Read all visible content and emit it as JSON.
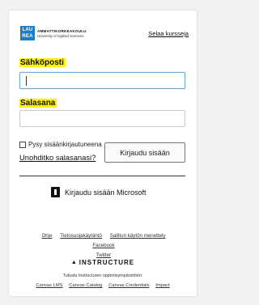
{
  "header": {
    "logo_mark": "LAU\nREA",
    "logo_line1": "AMMATTIKORKEAKOULU",
    "logo_line2": "University of Applied Sciences",
    "browse_courses": "Selaa kursseja"
  },
  "form": {
    "email_label": "Sähköposti",
    "password_label": "Salasana",
    "email_value": "",
    "password_value": "",
    "remember_label": "Pysy sisäänkirjautuneena",
    "forgot_link": "Unohditko salasanasi?",
    "login_button": "Kirjaudu sisään",
    "microsoft_login": "Kirjaudu sisään Microsoft"
  },
  "footer": {
    "links": [
      "Ohje",
      "Tietosuojakäytäntö",
      "Sallitun käytön menettely",
      "Facebook",
      "Twitter"
    ],
    "brand": "INSTRUCTURE",
    "tagline": "Tutustu Instructuren oppimisympäristöön:",
    "products": [
      "Canvas LMS",
      "Canvas Catalog",
      "Canvas Credentials",
      "Impact"
    ]
  },
  "colors": {
    "highlight": "#fff200",
    "logo_blue": "#1f7cc1",
    "focus_border": "#6aa8d9"
  },
  "icons": {
    "microsoft": "microsoft-icon",
    "instructure": "instructure-icon"
  }
}
